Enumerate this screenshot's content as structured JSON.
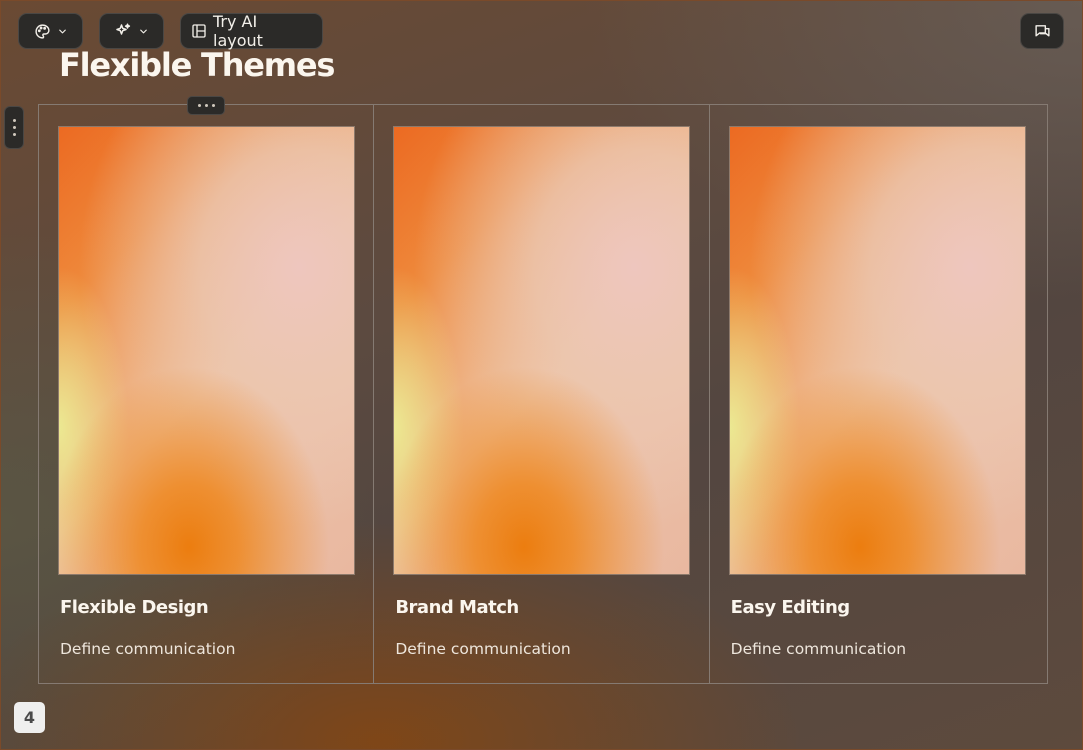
{
  "toolbar": {
    "theme_icon": "palette-icon",
    "ai_icon": "sparkles-icon",
    "layout_icon": "layout-icon",
    "layout_label": "Try AI layout",
    "comment_icon": "comment-icon"
  },
  "slide": {
    "title": "Flexible Themes",
    "cards": [
      {
        "title": "Flexible Design",
        "description": "Define communication"
      },
      {
        "title": "Brand Match",
        "description": "Define communication"
      },
      {
        "title": "Easy Editing",
        "description": "Define communication"
      }
    ]
  },
  "page_number": "4",
  "colors": {
    "background": "#5a4538",
    "toolbar_bg": "#2b2a28",
    "accent_orange": "#ec7a1f",
    "text_light": "#fbf6ee"
  }
}
